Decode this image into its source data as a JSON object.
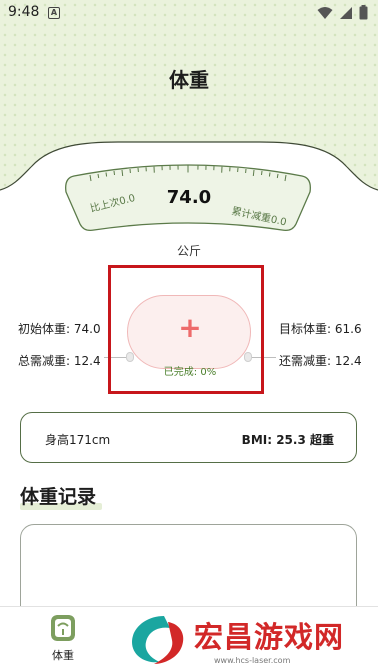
{
  "status_bar": {
    "time": "9:48",
    "a_icon": "A"
  },
  "header": {
    "title": "体重"
  },
  "gauge": {
    "current_value": "74.0",
    "left_label": "比上次0.0",
    "right_label": "累计减重0.0",
    "unit": "公斤"
  },
  "stats": {
    "initial_weight": "初始体重: 74.0",
    "target_weight": "目标体重: 61.6",
    "total_to_lose": "总需减重: 12.4",
    "remaining_to_lose": "还需减重: 12.4"
  },
  "add_record": {
    "plus_symbol": "+",
    "progress_label": "已完成: 0%",
    "progress_percent": 0
  },
  "body_info": {
    "height": "身高171cm",
    "bmi": "BMI: 25.3 超重"
  },
  "records": {
    "title": "体重记录"
  },
  "bottom_nav": {
    "items": [
      {
        "label": "体重",
        "icon": "scale-icon"
      }
    ]
  },
  "watermark": {
    "title": "宏昌游戏网",
    "url": "www.hcs-laser.com",
    "icon": "dragon-logo-icon"
  },
  "colors": {
    "header_bg": "#eaf2dc",
    "accent_green": "#556e46",
    "highlight_red": "#c7161b",
    "plus_pink": "#ee6b6b",
    "watermark_red": "#d22828"
  }
}
